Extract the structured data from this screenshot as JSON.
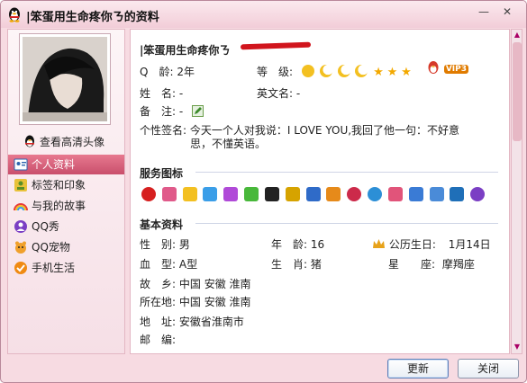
{
  "window": {
    "title": "|笨蛋用生命疼你ㄋ的资料"
  },
  "sidebar": {
    "hd_link": "查看高清头像",
    "items": [
      {
        "label": "个人资料",
        "icon": "profile-card-icon",
        "active": true
      },
      {
        "label": "标签和印象",
        "icon": "tag-icon",
        "active": false
      },
      {
        "label": "与我的故事",
        "icon": "rainbow-icon",
        "active": false
      },
      {
        "label": "QQ秀",
        "icon": "qq-show-icon",
        "active": false
      },
      {
        "label": "QQ宠物",
        "icon": "pet-icon",
        "active": false
      },
      {
        "label": "手机生活",
        "icon": "check-icon",
        "active": false
      }
    ]
  },
  "profile": {
    "name": "|笨蛋用生命疼你ㄋ",
    "qq_age_label": "Q　龄:",
    "qq_age": "2年",
    "level_label": "等　级:",
    "vip": "VIP3",
    "real_name_label": "姓　名:",
    "real_name": "-",
    "english_name_label": "英文名:",
    "english_name": "-",
    "remark_label": "备　注:",
    "remark": "-",
    "signature_label": "个性签名:",
    "signature_line1": "今天一个人对我说：I LOVE YOU,我回了他一句：不好意",
    "signature_line2": "思，不懂英语。"
  },
  "sections": {
    "services": "服务图标",
    "basic": "基本资料"
  },
  "basic": {
    "gender_label": "性　别:",
    "gender": "男",
    "age_label": "年　龄:",
    "age": "16",
    "lunar_bday_label": "公历生日:",
    "lunar_bday": "1月14日",
    "blood_label": "血　型:",
    "blood": "A型",
    "zodiac_label": "生　肖:",
    "zodiac": "猪",
    "star_label": "星　　座:",
    "star": "摩羯座",
    "hometown_label": "故　乡:",
    "hometown": "中国 安徽 淮南",
    "location_label": "所在地:",
    "location": "中国 安徽 淮南",
    "address_label": "地　址:",
    "address": "安徽省淮南市",
    "postcode_label": "邮　编:",
    "postcode": ""
  },
  "buttons": {
    "refresh": "更新",
    "close": "关闭"
  },
  "colors": {
    "accent": "#cf5674",
    "border": "#b9889a"
  }
}
